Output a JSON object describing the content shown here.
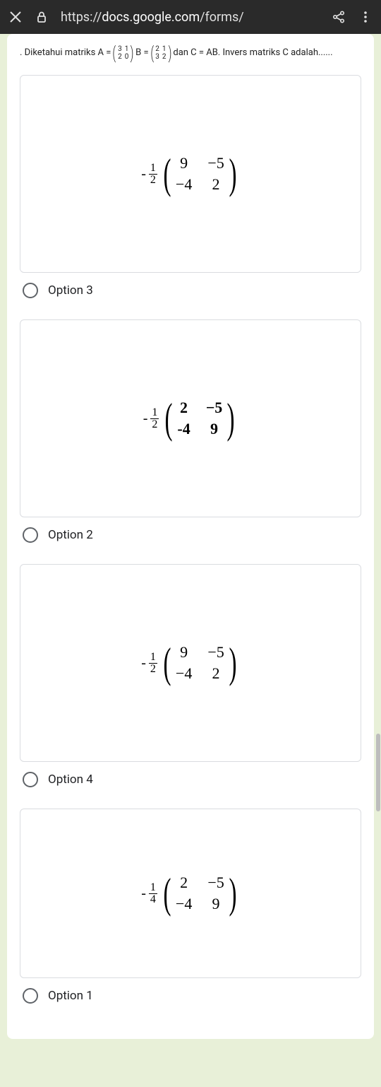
{
  "browser": {
    "url_prefix": "https://",
    "url_domain": "docs.google.com",
    "url_path": "/forms/"
  },
  "question": {
    "prefix": ". Diketahui matriks A =",
    "matrixA": [
      "3",
      "1",
      "2",
      "0"
    ],
    "mid1": "B =",
    "matrixB": [
      "2",
      "1",
      "3",
      "2"
    ],
    "suffix": "dan C = AB. Invers matriks C adalah......"
  },
  "options": [
    {
      "label": "Option 3",
      "frac_neg": "-",
      "frac_num": "1",
      "frac_den": "2",
      "cells": [
        "9",
        "−5",
        "−4",
        "2"
      ],
      "bold": false
    },
    {
      "label": "Option 2",
      "frac_neg": "-",
      "frac_num": "1",
      "frac_den": "2",
      "cells": [
        "2",
        "−5",
        "-4",
        "9"
      ],
      "bold": true
    },
    {
      "label": "Option 4",
      "frac_neg": "-",
      "frac_num": "1",
      "frac_den": "2",
      "cells": [
        "9",
        "−5",
        "−4",
        "2"
      ],
      "bold": false
    },
    {
      "label": "Option 1",
      "frac_neg": "-",
      "frac_num": "1",
      "frac_den": "4",
      "cells": [
        "2",
        "−5",
        "−4",
        "9"
      ],
      "bold": false
    }
  ]
}
